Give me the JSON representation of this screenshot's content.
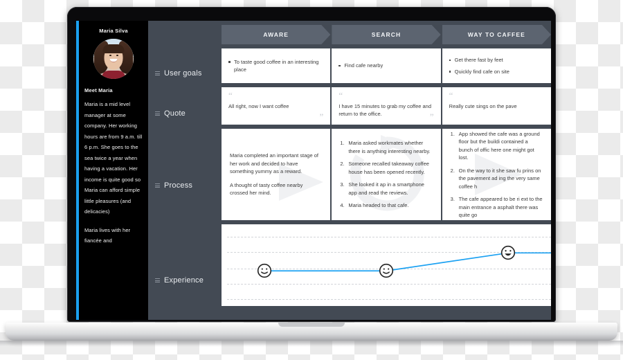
{
  "persona": {
    "name": "Maria Silva",
    "avatar_alt": "maria-portrait",
    "heading": "Meet Maria",
    "paragraphs": [
      "Maria is a mid level manager at some company. Her working hours are from 9 a.m. till 6 p.m. She goes to the sea twice a year when having a vacation. Her income is quite good so Maria can afford simple little pleasures (and delicacies)",
      "Maria lives with her fiancée and"
    ]
  },
  "row_labels": [
    {
      "label": "User goals"
    },
    {
      "label": "Quote"
    },
    {
      "label": "Process"
    },
    {
      "label": "Experience"
    }
  ],
  "stages": [
    {
      "label": "AWARE"
    },
    {
      "label": "SEARCH"
    },
    {
      "label": "WAY TO CAFFEE"
    }
  ],
  "user_goals": [
    {
      "items": [
        "To taste good coffee in an interesting place"
      ]
    },
    {
      "items": [
        "Find cafe nearby"
      ]
    },
    {
      "items": [
        "Get there fast by feet",
        "Quickly find cafe on site"
      ]
    }
  ],
  "quotes": [
    {
      "open": "“",
      "text": "All right, now I want coffee",
      "close": "”"
    },
    {
      "open": "“",
      "text": "I have 15 minutes to grab my coffee and return to the office.",
      "close": "”"
    },
    {
      "open": "“",
      "text": "Really cute sings on the pave",
      "close": "”"
    }
  ],
  "process": [
    {
      "type": "paragraphs",
      "paragraphs": [
        "Maria completed an important stage of her work and decided to have something yummy as a reward.",
        "A thought of tasty coffee nearby crossed her mind."
      ]
    },
    {
      "type": "ordered",
      "items": [
        "Maria asked workmates whether there is anything interesting nearby.",
        "Someone recalled takeaway coffee house has been opened recently.",
        "She looked it ap in a smartphone app and read the reviews.",
        "Maria headed to that cafe."
      ]
    },
    {
      "type": "ordered",
      "items": [
        "App showed the cafe was a ground floor but the buildi contained a bunch of offic here one might got lost.",
        "On the way to it she saw fu prins on the pavement ad ing the very same coffee h",
        "The cafe appeared to be ri ext to the main entrance a asphalt there was quite go"
      ]
    }
  ],
  "experience": {
    "gridlines": 5,
    "line_color": "#1ba1f2",
    "points": [
      {
        "x_pct": 13,
        "y_pct": 57,
        "mood": "neutral-smile-face"
      },
      {
        "x_pct": 50,
        "y_pct": 57,
        "mood": "neutral-smile-face"
      },
      {
        "x_pct": 87,
        "y_pct": 35,
        "mood": "happy-open-smile-face"
      }
    ]
  },
  "colors": {
    "accent": "#1ba1f2",
    "board_bg": "#434a54",
    "stage_bg": "#5c6470",
    "card_bg": "#ffffff",
    "persona_bg": "#000000"
  }
}
